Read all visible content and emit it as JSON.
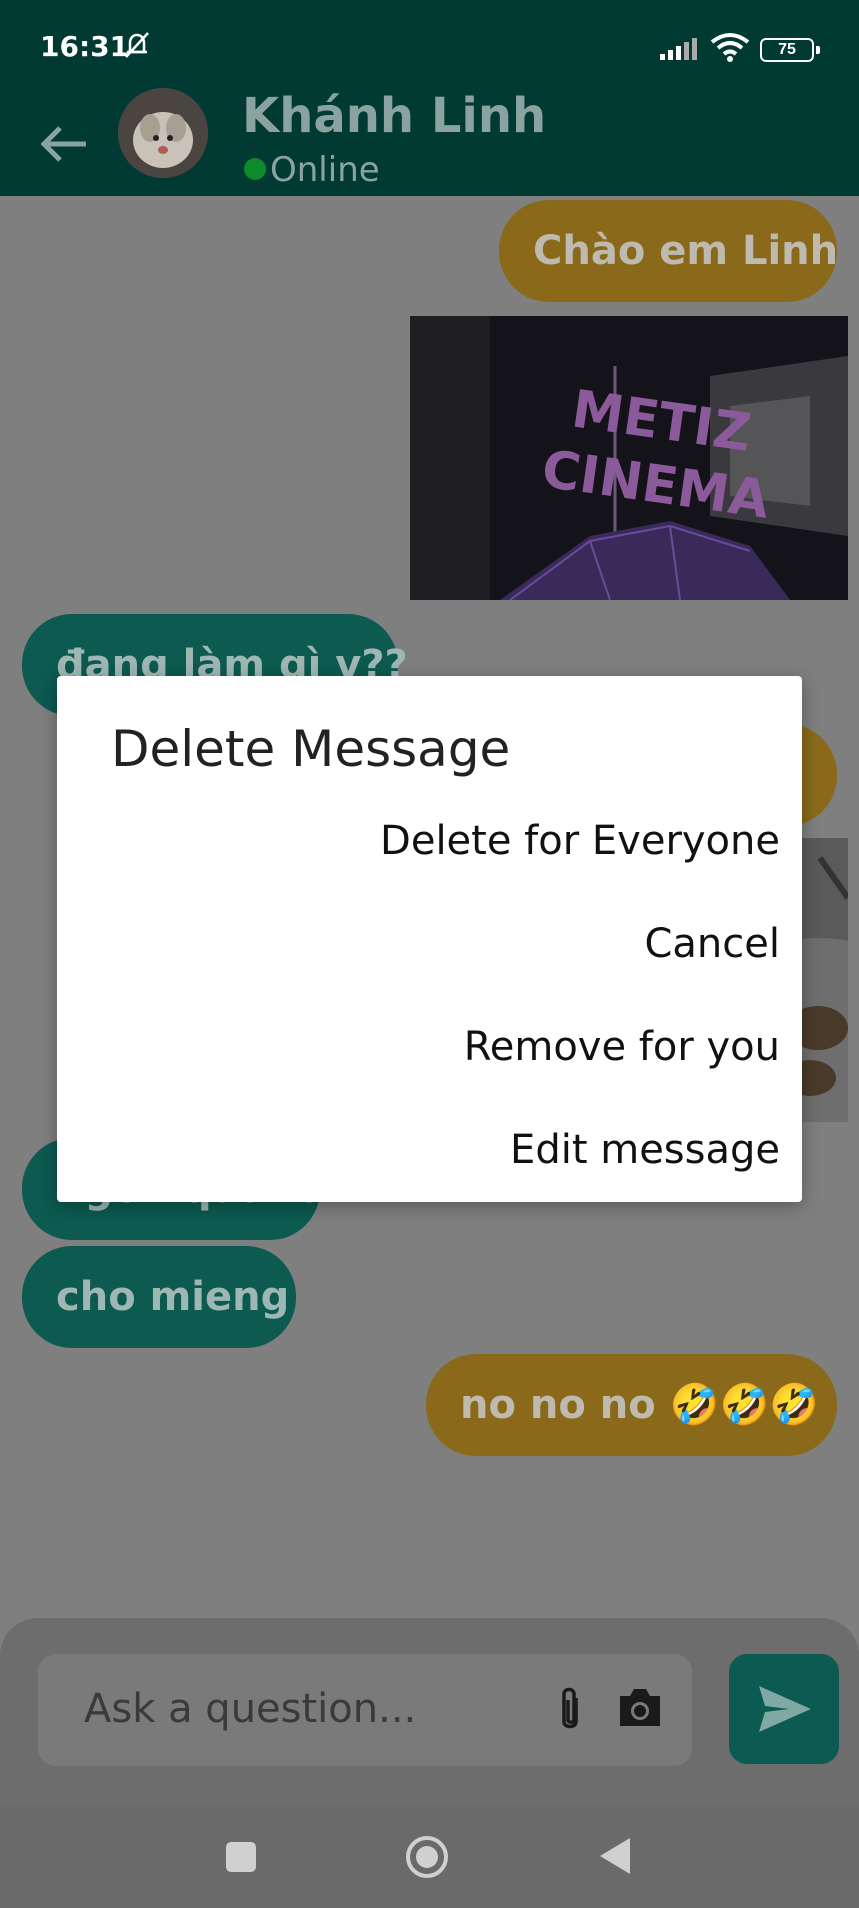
{
  "status_bar": {
    "time": "16:31",
    "battery": "75"
  },
  "header": {
    "contact_name": "Khánh Linh",
    "status": "Online"
  },
  "messages": [
    {
      "direction": "outgoing",
      "text": "Chào em Linh"
    },
    {
      "direction": "outgoing",
      "type": "image",
      "image_text_line1": "METIZ",
      "image_text_line2": "CINEMA"
    },
    {
      "direction": "incoming",
      "text": "đang làm gì v??"
    },
    {
      "direction": "incoming",
      "text": "ngon quá ta"
    },
    {
      "direction": "incoming",
      "text": "cho mieng"
    },
    {
      "direction": "outgoing",
      "text": "no no no 🤣🤣🤣"
    }
  ],
  "composer": {
    "placeholder": "Ask a question..."
  },
  "dialog": {
    "title": "Delete Message",
    "actions": [
      "Delete for Everyone",
      "Cancel",
      "Remove for you",
      "Edit message"
    ]
  },
  "colors": {
    "header_bg": "#003a33",
    "outgoing_bubble": "#f5a623",
    "incoming_bubble": "#117a6d",
    "online_dot": "#1cc23c"
  }
}
